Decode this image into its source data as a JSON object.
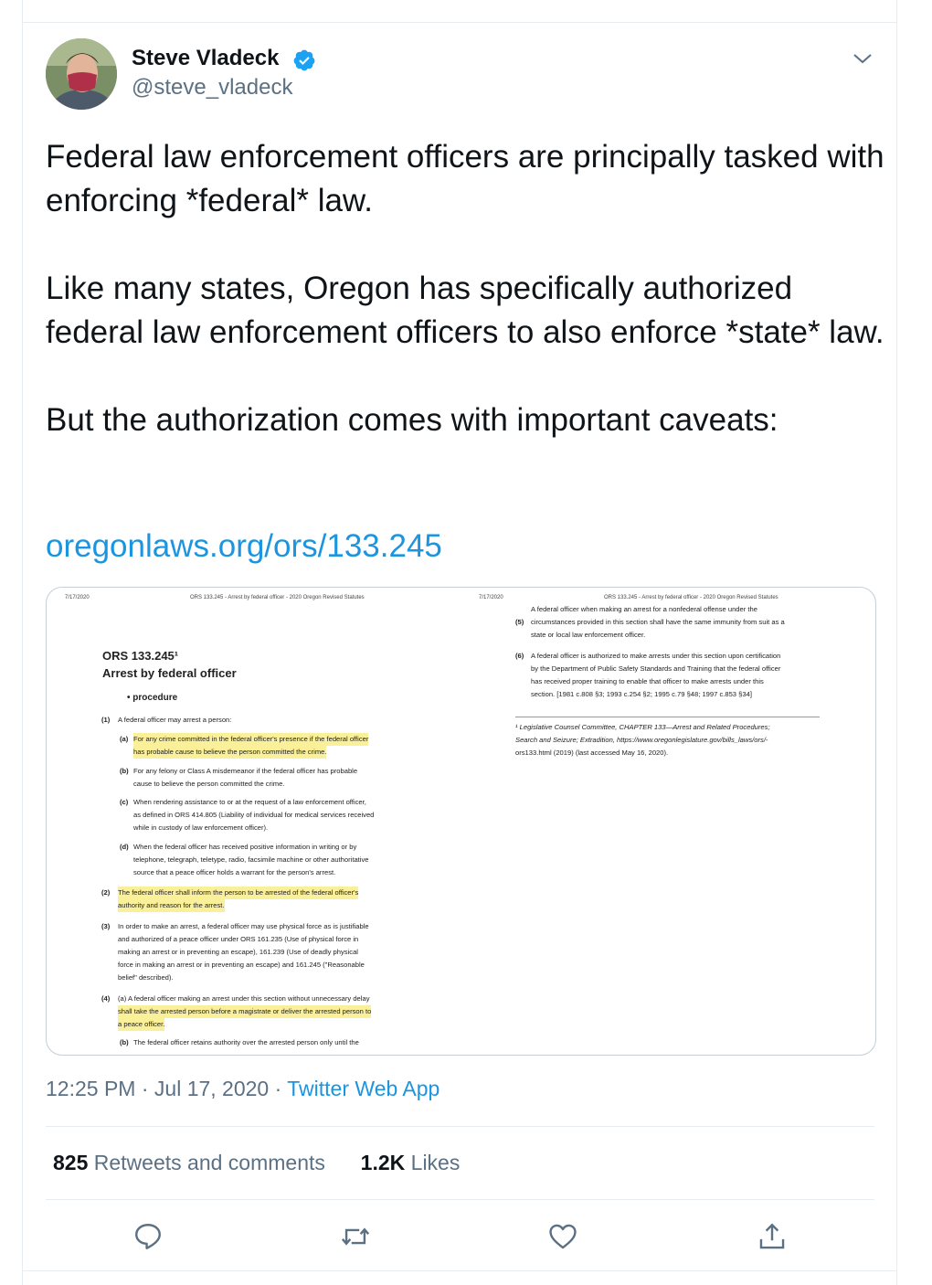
{
  "tweet": {
    "author_name": "Steve Vladeck",
    "handle": "@steve_vladeck",
    "paragraph_1": "Federal law enforcement officers are principally tasked with enforcing *federal* law.",
    "paragraph_2": "Like many states, Oregon has specifically authorized federal law enforcement officers to also enforce *state* law.",
    "paragraph_3": "But the authorization comes with important caveats:",
    "link_text": "oregonlaws.org/ors/133.245",
    "time": "12:25 PM",
    "dot_1": "·",
    "date": "Jul 17, 2020",
    "dot_2": "·",
    "source": "Twitter Web App"
  },
  "stats": {
    "retweets_count": "825",
    "retweets_label": "Retweets and comments",
    "likes_count": "1.2K",
    "likes_label": "Likes"
  },
  "document": {
    "left_page": {
      "date": "7/17/2020",
      "header": "ORS 133.245 - Arrest by federal officer - 2020 Oregon Revised Statutes",
      "title": "ORS 133.245¹",
      "subtitle": "Arrest by federal officer",
      "procedure": "• procedure",
      "s1_num": "(1)",
      "s1_text": "A federal officer may arrest a person:",
      "a_num": "(a)",
      "a_line1": "For any crime committed in the federal officer's presence if the federal officer",
      "a_line2": "has probable cause to believe the person committed the crime.",
      "b_num": "(b)",
      "b_line1": "For any felony or Class A misdemeanor if the federal officer has probable",
      "b_line2": "cause to believe the person committed the crime.",
      "c_num": "(c)",
      "c_line1": "When rendering assistance to or at the request of a law enforcement officer,",
      "c_line2": "as defined in ORS 414.805 (Liability of individual for medical services received",
      "c_line3": "while in custody of law enforcement officer).",
      "d_num": "(d)",
      "d_line1": "When the federal officer has received positive information in writing or by",
      "d_line2": "telephone, telegraph, teletype, radio, facsimile machine or other authoritative",
      "d_line3": "source that a peace officer holds a warrant for the person's arrest.",
      "s2_num": "(2)",
      "s2_line1": "The federal officer shall inform the person to be arrested of the federal officer's",
      "s2_line2": "authority and reason for the arrest.",
      "s3_num": "(3)",
      "s3_line1": "In order to make an arrest, a federal officer may use physical force as is justifiable",
      "s3_line2": "and authorized of a peace officer under ORS 161.235 (Use of physical force in",
      "s3_line3": "making an arrest or in preventing an escape), 161.239 (Use of deadly physical",
      "s3_line4": "force in making an arrest or in preventing an escape) and 161.245 (\"Reasonable",
      "s3_line5": "belief\" described).",
      "s4_num": "(4)",
      "s4_line1a": "(a) A federal officer making an arrest under this section without unnecessary delay",
      "s4_line2": "shall take the arrested person before a magistrate or deliver the arrested person to",
      "s4_line3": "a peace officer.",
      "s4b_num": "(b)",
      "s4b_line1": "The federal officer retains authority over the arrested person only until the"
    },
    "right_page": {
      "date": "7/17/2020",
      "header": "ORS 133.245 - Arrest by federal officer - 2020 Oregon Revised Statutes",
      "s5_num": "(5)",
      "s5_line1": "A federal officer when making an arrest for a nonfederal offense under the",
      "s5_line2": "circumstances provided in this section shall have the same immunity from suit as a",
      "s5_line3": "state or local law enforcement officer.",
      "s6_num": "(6)",
      "s6_line1": "A federal officer is authorized to make arrests under this section upon certification",
      "s6_line2": "by the Department of Public Safety Standards and Training that the federal officer",
      "s6_line3": "has received proper training to enable that officer to make arrests under this",
      "s6_line4": "section. [1981 c.808 §3; 1993 c.254 §2; 1995 c.79 §48; 1997 c.853 §34]",
      "fn_line1": "¹ Legislative Counsel Committee, CHAPTER 133—Arrest and Related Procedures;",
      "fn_line2": "Search and Seizure; Extradition, https://www.oregonlegislature.gov/bills_laws/ors/-",
      "fn_line3": "ors133.html (2019) (last accessed May 16, 2020)."
    }
  },
  "icons": {
    "verified": "verified-badge-icon",
    "more": "chevron-down-icon",
    "reply": "reply-icon",
    "retweet": "retweet-icon",
    "like": "heart-icon",
    "share": "share-icon"
  },
  "colors": {
    "link": "#1b95e0",
    "secondary_text": "#5b7083",
    "highlight": "#fbf09a"
  }
}
